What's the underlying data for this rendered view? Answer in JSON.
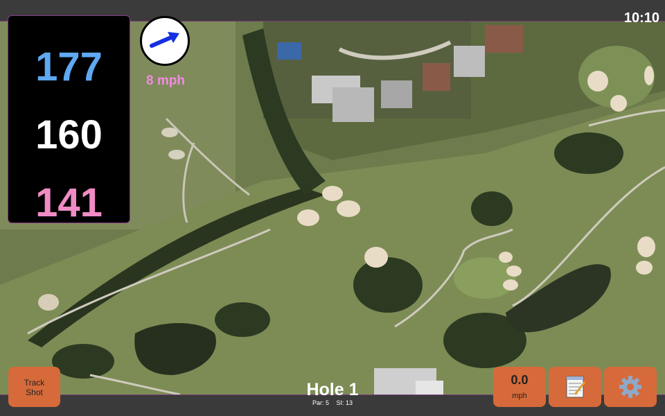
{
  "status": {
    "clock": "10:10"
  },
  "distances": {
    "back": "177",
    "middle": "160",
    "front": "141"
  },
  "wind": {
    "speed": "8 mph",
    "icon": "wind-arrow-icon"
  },
  "hole": {
    "title": "Hole 1",
    "par": "Par: 5",
    "si": "SI: 13"
  },
  "buttons": {
    "track_shot_line1": "Track",
    "track_shot_line2": "Shot",
    "speed_value": "0.0",
    "speed_unit": "mph",
    "notes_icon": "notepad-icon",
    "settings_icon": "gear-icon"
  },
  "colors": {
    "back_distance": "#5ea9f2",
    "middle_distance": "#ffffff",
    "front_distance": "#f08bc4",
    "button": "#d66a3a",
    "wind_text": "#f08ce0"
  }
}
